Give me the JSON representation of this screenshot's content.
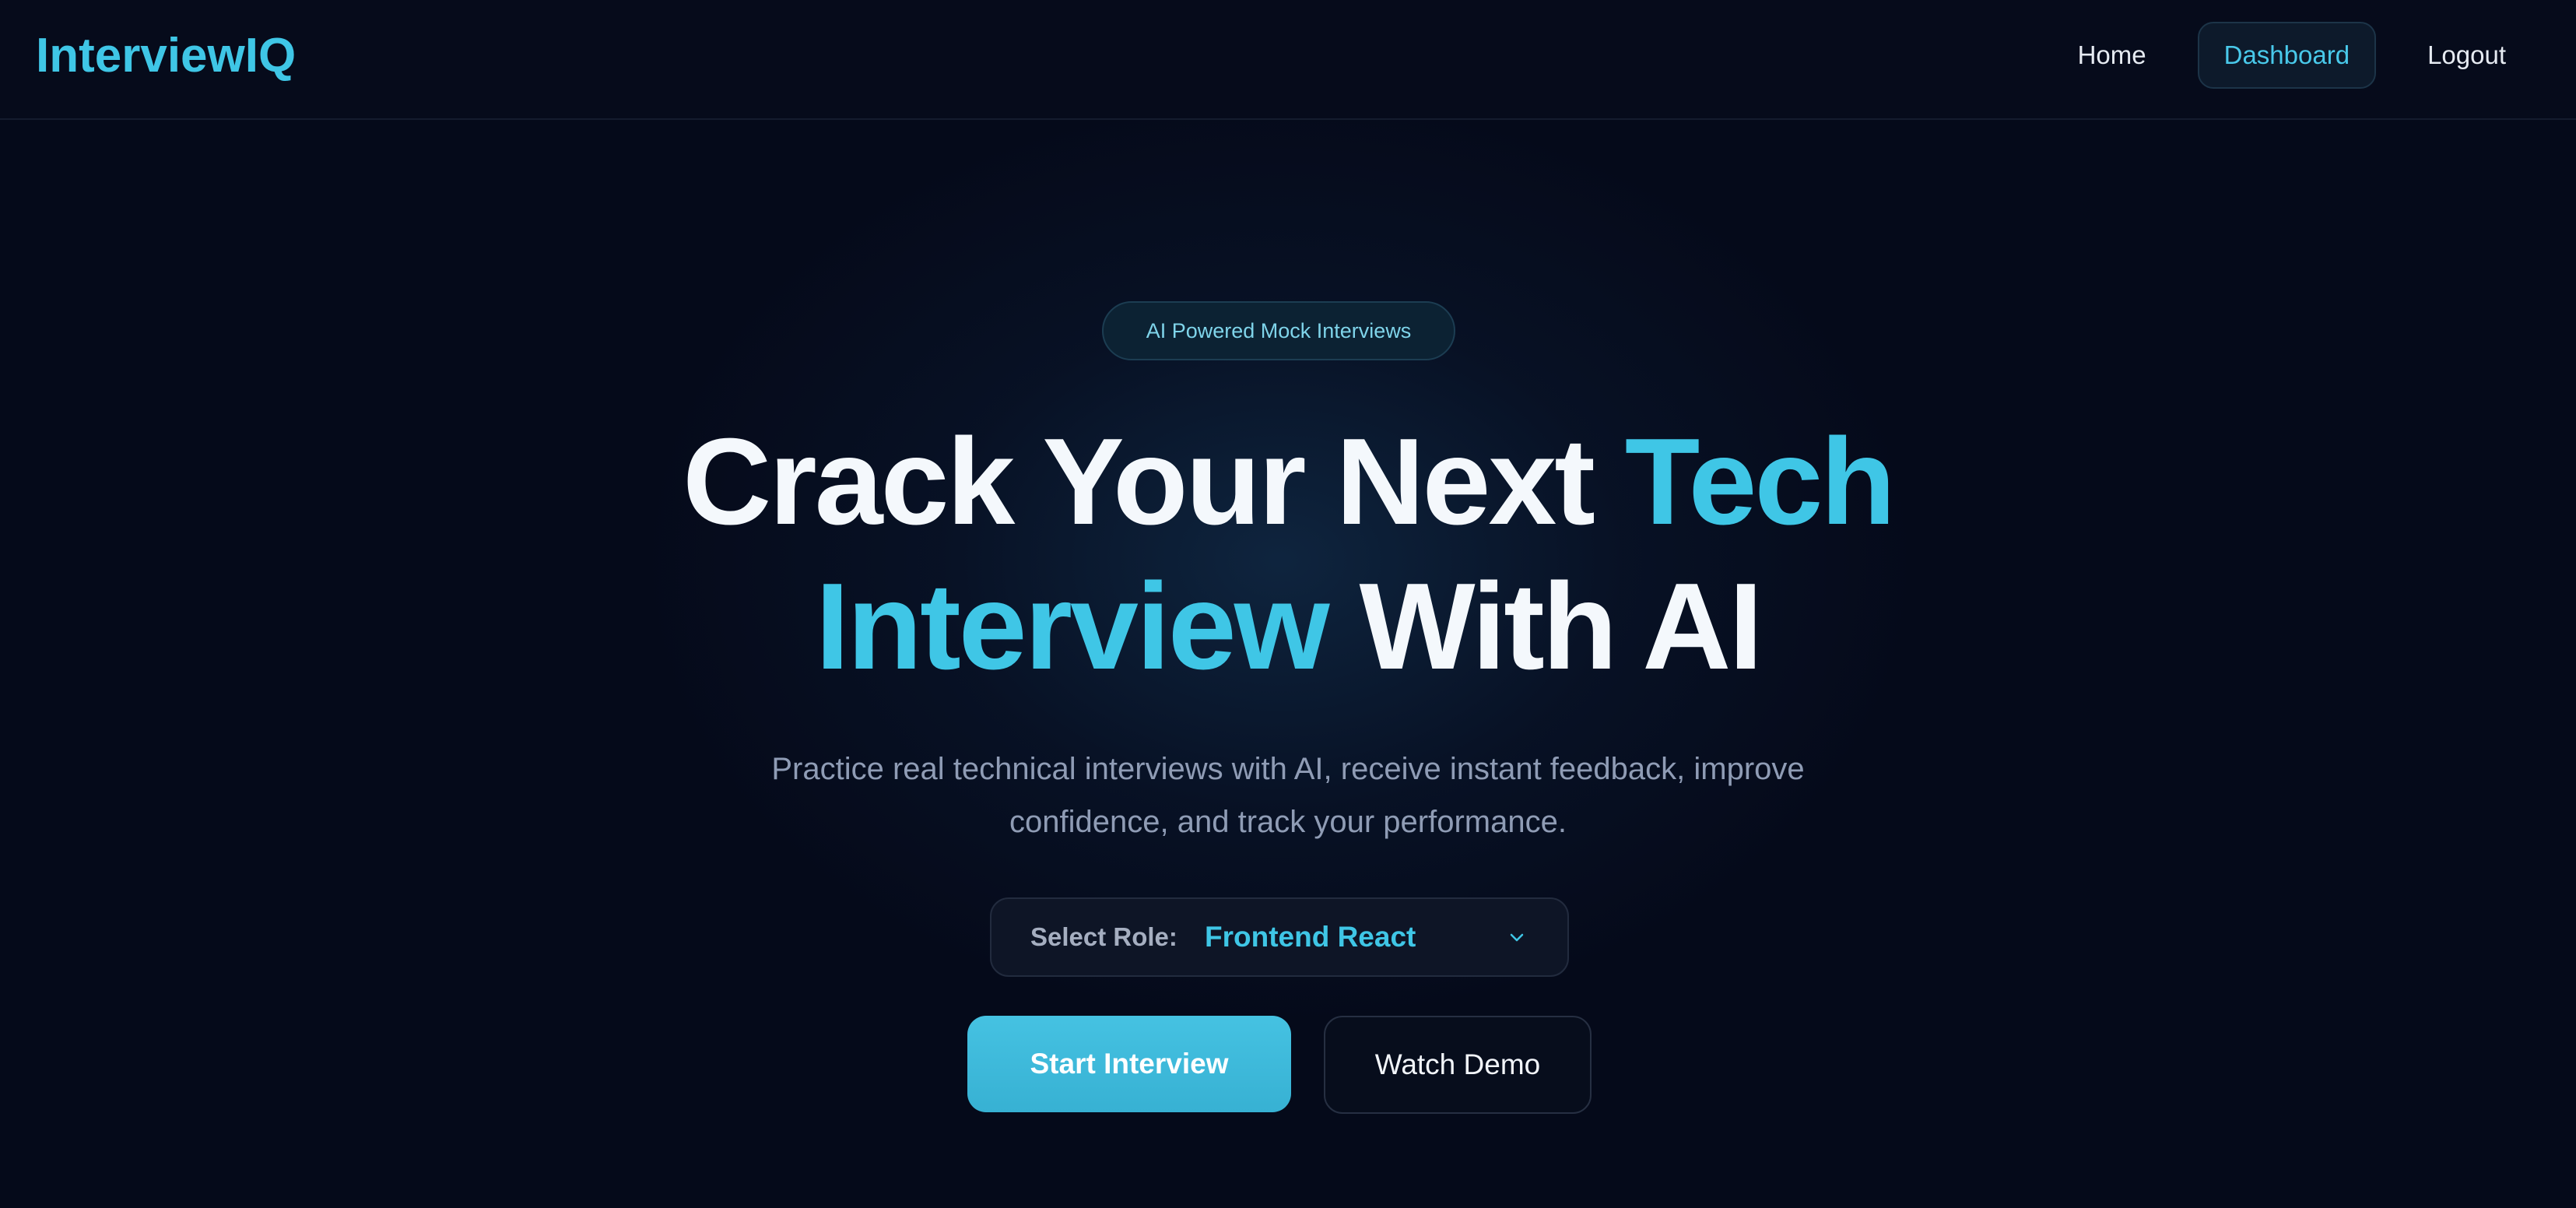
{
  "nav": {
    "logo": "InterviewIQ",
    "links": [
      {
        "label": "Home",
        "active": false
      },
      {
        "label": "Dashboard",
        "active": true
      },
      {
        "label": "Logout",
        "active": false
      }
    ]
  },
  "hero": {
    "badge": "AI Powered Mock Interviews",
    "headline": {
      "part1": "Crack Your Next ",
      "part2_accent": "Tech",
      "part3_accent": "Interview",
      "part4": " With AI"
    },
    "subtitle_line1": "Practice real technical interviews with AI, receive instant feedback, improve",
    "subtitle_line2": "confidence, and track your performance.",
    "role_select": {
      "label": "Select Role:",
      "value": "Frontend React",
      "icon": "chevron-down-icon"
    },
    "primary_button": "Start Interview",
    "secondary_button": "Watch Demo"
  },
  "colors": {
    "background": "#050a1a",
    "accent": "#3fc6e6",
    "primary_button": "#3fb9da",
    "muted_text": "#8f9cb5"
  }
}
